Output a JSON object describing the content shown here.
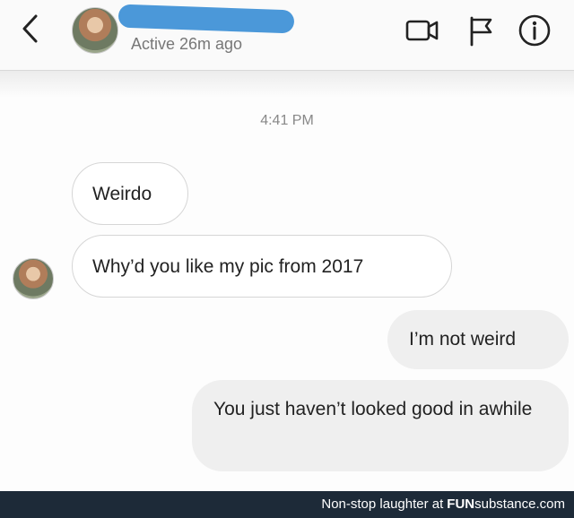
{
  "header": {
    "status": "Active 26m ago",
    "icons": [
      "back-chevron-icon",
      "video-call-icon",
      "flag-icon",
      "info-icon"
    ]
  },
  "conversation": {
    "timestamp": "4:41 PM",
    "messages": [
      {
        "direction": "incoming",
        "text": "Weirdo"
      },
      {
        "direction": "incoming",
        "text": "Why’d you like my pic from 2017"
      },
      {
        "direction": "outgoing",
        "text": "I’m not weird"
      },
      {
        "direction": "outgoing",
        "text": "You just haven’t looked good in awhile"
      }
    ]
  },
  "footer": {
    "tagline": "Non-stop laughter at",
    "brand_prefix": "FUN",
    "brand_suffix": "substance.com"
  },
  "colors": {
    "redaction": "#3c8fd6",
    "outgoing_bubble": "#efefef",
    "footer_bg": "#1d2a38"
  }
}
